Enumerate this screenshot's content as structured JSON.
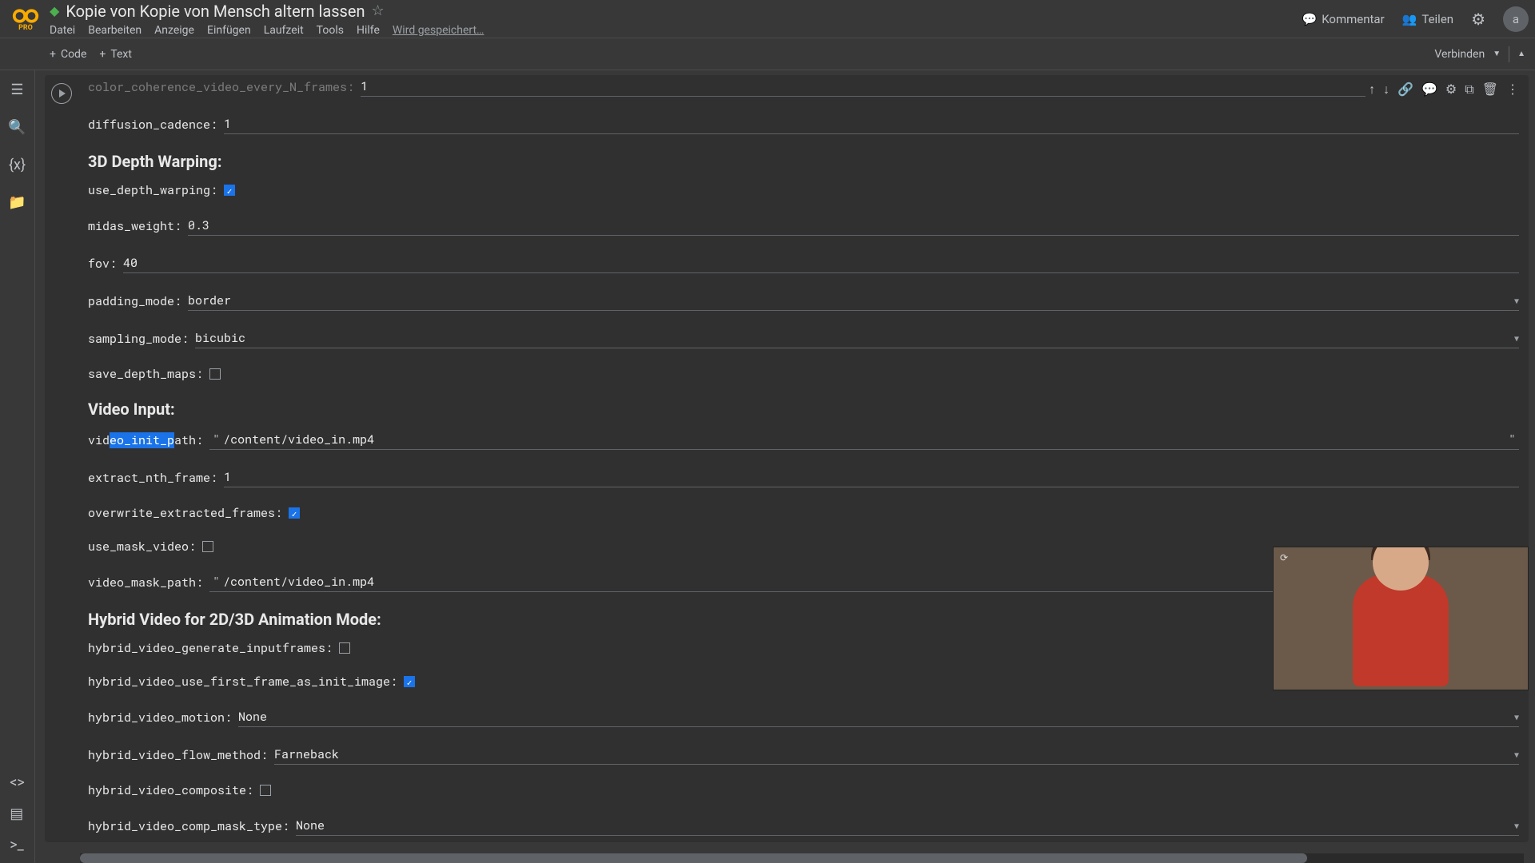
{
  "header": {
    "pro": "PRO",
    "title": "Kopie von Kopie von Mensch altern lassen",
    "menu": [
      "Datei",
      "Bearbeiten",
      "Anzeige",
      "Einfügen",
      "Laufzeit",
      "Tools",
      "Hilfe"
    ],
    "save_status": "Wird gespeichert…",
    "comment": "Kommentar",
    "share": "Teilen",
    "avatar": "a"
  },
  "subheader": {
    "code": "Code",
    "text": "Text",
    "connect": "Verbinden"
  },
  "sections": {
    "depth": "3D Depth Warping:",
    "video": "Video Input:",
    "hybrid": "Hybrid Video for 2D/3D Animation Mode:"
  },
  "fields": {
    "color_coherence_every_n": {
      "label": "color_coherence_video_every_N_frames:",
      "value": "1"
    },
    "diffusion_cadence": {
      "label": "diffusion_cadence:",
      "value": "1"
    },
    "use_depth_warping": {
      "label": "use_depth_warping:",
      "checked": true
    },
    "midas_weight": {
      "label": "midas_weight:",
      "value": "0.3"
    },
    "fov": {
      "label": "fov:",
      "value": "40"
    },
    "padding_mode": {
      "label": "padding_mode:",
      "value": "border"
    },
    "sampling_mode": {
      "label": "sampling_mode:",
      "value": "bicubic"
    },
    "save_depth_maps": {
      "label": "save_depth_maps:",
      "checked": false
    },
    "video_init_path": {
      "label_pre": "vid",
      "label_hl": "eo_init_p",
      "label_post": "ath:",
      "value": "/content/video_in.mp4"
    },
    "extract_nth_frame": {
      "label": "extract_nth_frame:",
      "value": "1"
    },
    "overwrite_extracted_frames": {
      "label": "overwrite_extracted_frames:",
      "checked": true
    },
    "use_mask_video": {
      "label": "use_mask_video:",
      "checked": false
    },
    "video_mask_path": {
      "label": "video_mask_path:",
      "value": "/content/video_in.mp4"
    },
    "hybrid_generate": {
      "label": "hybrid_video_generate_inputframes:",
      "checked": false
    },
    "hybrid_first_frame": {
      "label": "hybrid_video_use_first_frame_as_init_image:",
      "checked": true
    },
    "hybrid_motion": {
      "label": "hybrid_video_motion:",
      "value": "None"
    },
    "hybrid_flow": {
      "label": "hybrid_video_flow_method:",
      "value": "Farneback"
    },
    "hybrid_composite": {
      "label": "hybrid_video_composite:",
      "checked": false
    },
    "hybrid_mask_type": {
      "label": "hybrid_video_comp_mask_type:",
      "value": "None"
    }
  }
}
